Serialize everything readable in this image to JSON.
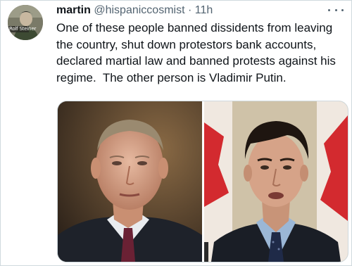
{
  "tweet": {
    "author_name": "martin",
    "handle": "@hispaniccosmist",
    "separator": "·",
    "time": "11h",
    "text": "One of these people banned dissidents from leaving the country, shut down protestors bank accounts, declared martial law and banned protests against his regime.  The other person is Vladimir Putin.",
    "avatar_overlay_text": "Rolf Steiner",
    "more_icon": "more-horizontal-icon"
  },
  "media": {
    "photos": [
      {
        "subject": "man in dark suit with white shirt and burgundy tie, dark background"
      },
      {
        "subject": "man in dark suit with blue shirt and navy tie, red and white flags behind"
      }
    ]
  }
}
